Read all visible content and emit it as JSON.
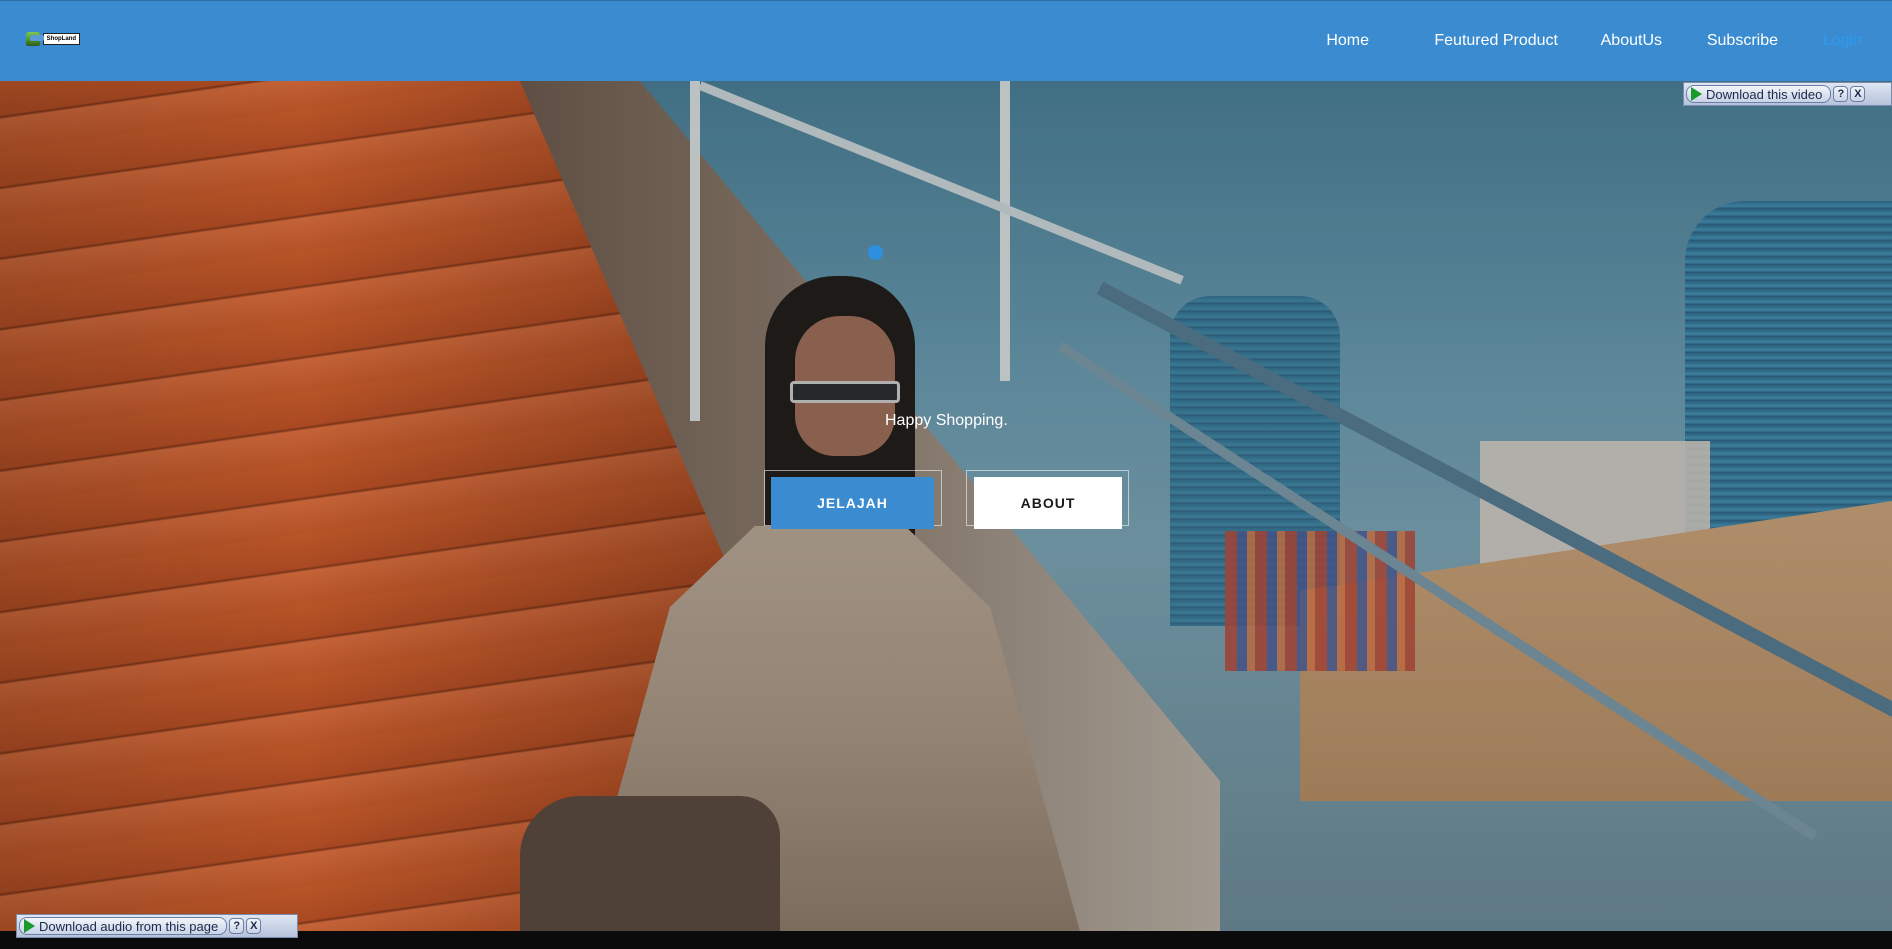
{
  "header": {
    "logo_text": "ShopLand",
    "nav": [
      {
        "label": "Home",
        "name": "nav-home"
      },
      {
        "label": "Feutured Product",
        "name": "nav-featured-product"
      },
      {
        "label": "AboutUs",
        "name": "nav-about-us"
      },
      {
        "label": "Subscribe",
        "name": "nav-subscribe"
      },
      {
        "label": "Login",
        "name": "nav-login"
      }
    ]
  },
  "hero": {
    "tagline": "Happy Shopping.",
    "primary_button": "JELAJAH",
    "secondary_button": "ABOUT"
  },
  "widgets": {
    "video_download": {
      "label": "Download this video",
      "help": "?",
      "close": "X"
    },
    "audio_download": {
      "label": "Download audio from this page",
      "help": "?",
      "close": "X"
    }
  },
  "colors": {
    "brand": "#3a8bcf",
    "login_link": "#2d9bf0",
    "indicator_dot": "#2d8fe0"
  }
}
